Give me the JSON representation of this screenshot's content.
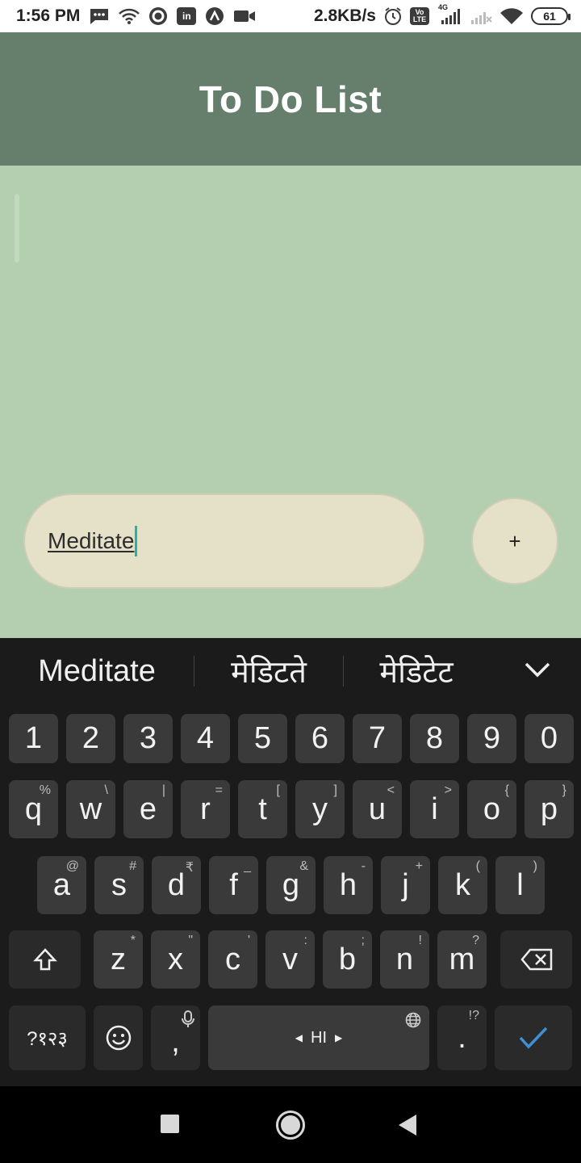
{
  "status_bar": {
    "time": "1:56 PM",
    "net_speed": "2.8KB/s",
    "battery": "61",
    "signal_label": "4G",
    "volte": "Vo LTE",
    "linkedin": "in"
  },
  "app": {
    "title": "To Do List"
  },
  "input": {
    "value": "Meditate"
  },
  "add_button": {
    "label": "+"
  },
  "keyboard": {
    "suggestions": [
      "Meditate",
      "मेडिटते",
      "मेडिटेट"
    ],
    "number_row": [
      "1",
      "2",
      "3",
      "4",
      "5",
      "6",
      "7",
      "8",
      "9",
      "0"
    ],
    "row1": [
      {
        "k": "q",
        "h": "%"
      },
      {
        "k": "w",
        "h": "\\"
      },
      {
        "k": "e",
        "h": "|"
      },
      {
        "k": "r",
        "h": "="
      },
      {
        "k": "t",
        "h": "["
      },
      {
        "k": "y",
        "h": "]"
      },
      {
        "k": "u",
        "h": "<"
      },
      {
        "k": "i",
        "h": ">"
      },
      {
        "k": "o",
        "h": "{"
      },
      {
        "k": "p",
        "h": "}"
      }
    ],
    "row2": [
      {
        "k": "a",
        "h": "@"
      },
      {
        "k": "s",
        "h": "#"
      },
      {
        "k": "d",
        "h": "₹"
      },
      {
        "k": "f",
        "h": "_"
      },
      {
        "k": "g",
        "h": "&"
      },
      {
        "k": "h",
        "h": "-"
      },
      {
        "k": "j",
        "h": "+"
      },
      {
        "k": "k",
        "h": "("
      },
      {
        "k": "l",
        "h": ")"
      }
    ],
    "row3": [
      {
        "k": "z",
        "h": "*"
      },
      {
        "k": "x",
        "h": "\""
      },
      {
        "k": "c",
        "h": "'"
      },
      {
        "k": "v",
        "h": ":"
      },
      {
        "k": "b",
        "h": ";"
      },
      {
        "k": "n",
        "h": "!"
      },
      {
        "k": "m",
        "h": "?"
      }
    ],
    "symbols_key": "?१२३",
    "comma": ",",
    "space_label": "HI",
    "period": ".",
    "period_hint": "!?",
    "colors": {
      "enter_check": "#3d8fd6"
    }
  }
}
